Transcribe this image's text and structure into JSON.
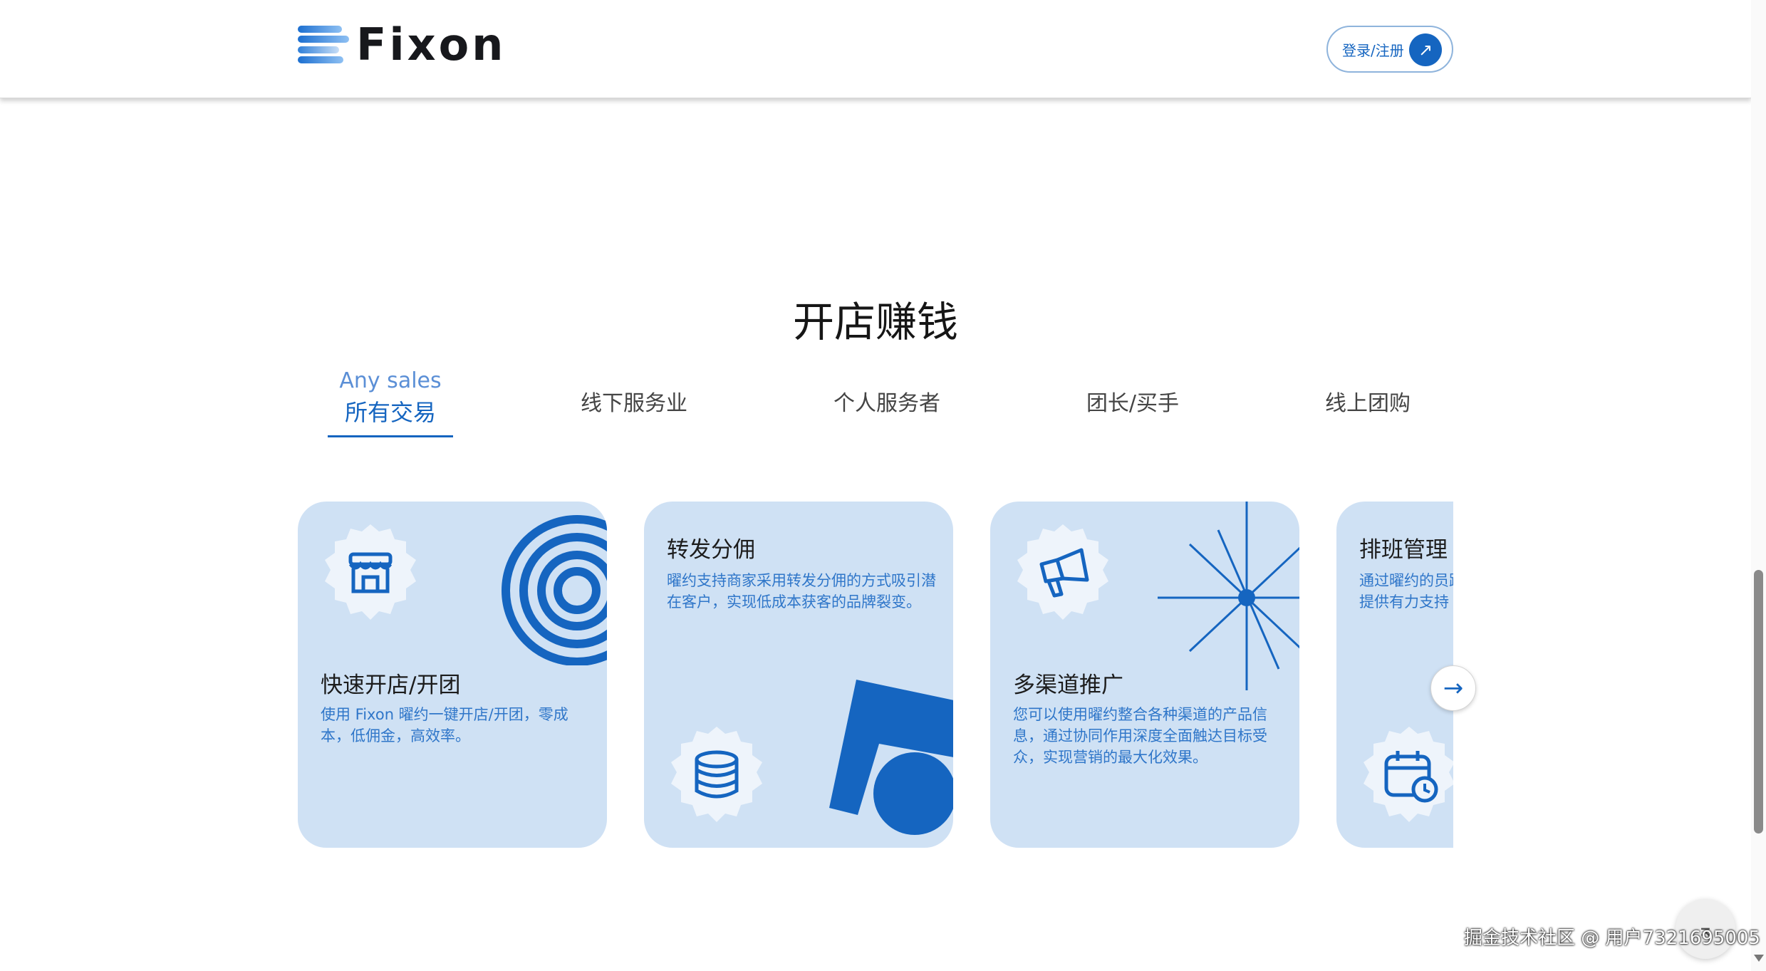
{
  "header": {
    "logo_text": "Fixon",
    "login_label": "登录/注册",
    "login_arrow": "↗"
  },
  "section": {
    "title": "开店赚钱"
  },
  "tabs": [
    {
      "en": "Any sales",
      "label": "所有交易",
      "active": true
    },
    {
      "label": "线下服务业"
    },
    {
      "label": "个人服务者"
    },
    {
      "label": "团长/买手"
    },
    {
      "label": "线上团购"
    }
  ],
  "cards": [
    {
      "title": "快速开店/开团",
      "desc": "使用 Fixon 曜约一键开店/开团，零成本，低佣金，高效率。",
      "icon": "store-icon"
    },
    {
      "title": "转发分佣",
      "desc": "曜约支持商家采用转发分佣的方式吸引潜在客户，实现低成本获客的品牌裂变。",
      "icon": "database-icon"
    },
    {
      "title": "多渠道推广",
      "desc": "您可以使用曜约整合各种渠道的产品信息，通过协同作用深度全面触达目标受众，实现营销的最大化效果。",
      "icon": "megaphone-icon"
    },
    {
      "title": "排班管理",
      "desc": "通过曜约的员跟踪员工销售出数据，全面提供有力支持",
      "icon": "calendar-clock-icon"
    }
  ],
  "controls": {
    "next_arrow": "→",
    "top_arrow": "⌅"
  },
  "watermark": "掘金技术社区 @ 用户7321695005",
  "colors": {
    "brand_blue": "#1565c0",
    "card_bg": "#cfe1f4",
    "accent_text": "#2f76c9"
  }
}
